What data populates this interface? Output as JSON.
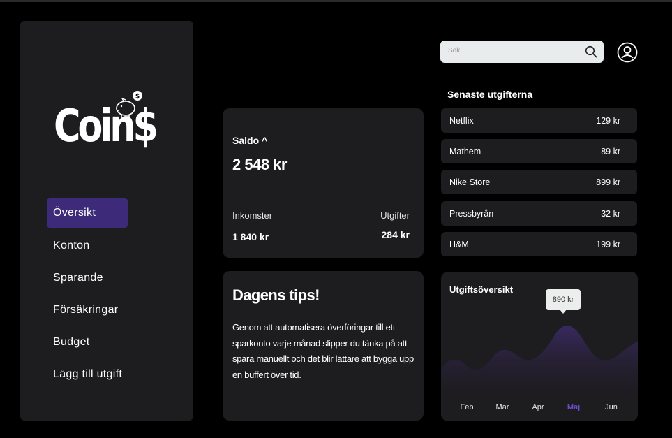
{
  "app": {
    "logo_text": "Coin$"
  },
  "search": {
    "placeholder": "Sök"
  },
  "nav": {
    "items": [
      {
        "label": "Översikt",
        "active": true
      },
      {
        "label": "Konton"
      },
      {
        "label": "Sparande"
      },
      {
        "label": "Försäkringar"
      },
      {
        "label": "Budget"
      },
      {
        "label": "Lägg till utgift"
      }
    ]
  },
  "balance": {
    "title": "Saldo ^",
    "value": "2 548 kr",
    "income_label": "Inkomster",
    "income_value": "1 840 kr",
    "expenses_label": "Utgifter",
    "expenses_value": "284 kr"
  },
  "tips": {
    "title": "Dagens tips!",
    "text": "Genom att automatisera överföringar till ett sparkonto varje månad slipper du tänka på att spara manuellt och det blir lättare att bygga upp en buffert över tid."
  },
  "recent_expenses": {
    "title": "Senaste utgifterna",
    "items": [
      {
        "name": "Netflix",
        "amount": "129 kr"
      },
      {
        "name": "Mathem",
        "amount": "89 kr"
      },
      {
        "name": "Nike Store",
        "amount": "899 kr"
      },
      {
        "name": "Pressbyrån",
        "amount": "32 kr"
      },
      {
        "name": "H&M",
        "amount": "199 kr"
      }
    ]
  },
  "expense_overview": {
    "title": "Utgiftsöversikt",
    "tooltip": "890 kr",
    "months": [
      "Feb",
      "Mar",
      "Apr",
      "Maj",
      "Jun"
    ],
    "active_month": "Maj"
  },
  "colors": {
    "background": "#000000",
    "card": "#1d1c1f",
    "accent": "#3d2a78",
    "active_month": "#6b4cc9"
  },
  "chart_data": {
    "type": "area",
    "categories": [
      "Feb",
      "Mar",
      "Apr",
      "Maj",
      "Jun"
    ],
    "highlighted": {
      "category": "Maj",
      "label": "890 kr"
    }
  }
}
